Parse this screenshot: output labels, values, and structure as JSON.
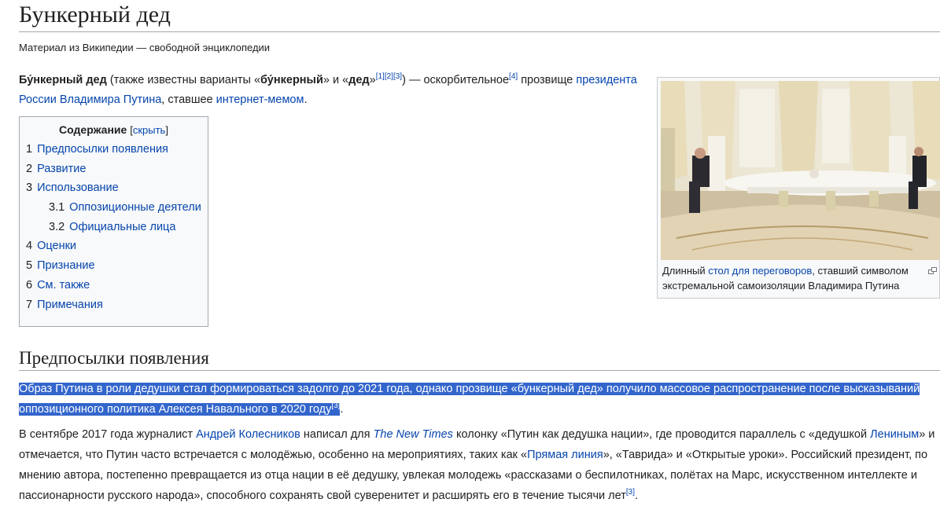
{
  "page": {
    "title": "Бункерный дед",
    "tagline": "Материал из Википедии — свободной энциклопедии"
  },
  "lead": {
    "term": "Бу́нкерный дед",
    "t1": " (также известны варианты «",
    "variant1": "бу́нкерный",
    "t2": "» и «",
    "variant2": "дед",
    "t3": "»",
    "ref1": "[1]",
    "ref2": "[2]",
    "ref3": "[3]",
    "t4": ") — оскорбительное",
    "ref4": "[4]",
    "t5": " прозвище ",
    "link1": "президента России Владимира Путина",
    "t6": ", ставшее ",
    "link2": "интернет-мемом",
    "t7": "."
  },
  "toc": {
    "heading": "Содержание",
    "toggle_open": "[",
    "toggle": "скрыть",
    "toggle_close": "]",
    "items": [
      {
        "num": "1",
        "label": "Предпосылки появления"
      },
      {
        "num": "2",
        "label": "Развитие"
      },
      {
        "num": "3",
        "label": "Использование"
      },
      {
        "num": "3.1",
        "label": "Оппозиционные деятели"
      },
      {
        "num": "3.2",
        "label": "Официальные лица"
      },
      {
        "num": "4",
        "label": "Оценки"
      },
      {
        "num": "5",
        "label": "Признание"
      },
      {
        "num": "6",
        "label": "См. также"
      },
      {
        "num": "7",
        "label": "Примечания"
      }
    ]
  },
  "figure": {
    "c1": "Длинный ",
    "link": "стол для переговоров",
    "c2": ", ставший символом экстремальной самоизоляции Владимира Путина"
  },
  "section": {
    "heading": "Предпосылки появления",
    "p1_text": "Образ Путина в роли дедушки стал формироваться задолго до 2021 года, однако прозвище «бункерный дед» получило массовое распространение после высказываний оппозиционного политика Алексея Навального в 2020 году",
    "p1_ref": "[3]",
    "p1_end": ".",
    "p2": {
      "a": "В сентябре 2017 года журналист ",
      "link1": "Андрей Колесников",
      "b": " написал для ",
      "link2": "The New Times",
      "c": " колонку «Путин как дедушка нации», где проводится параллель с «дедушкой ",
      "link3": "Лениным",
      "d": "» и отмечается, что Путин часто встречается с молодёжью, особенно на мероприятиях, таких как «",
      "link4": "Прямая линия",
      "e": "», «Таврида» и «Открытые уроки». Российский президент, по мнению автора, постепенно превращается из отца нации в её дедушку, увлекая молодежь «рассказами о беспилотниках, полётах на Марс, искусственном интеллекте и пассионарности русского народа», способного сохранять свой суверенитет и расширять его в течение тысячи лет",
      "ref": "[3]",
      "f": "."
    }
  },
  "icons": {
    "magnify": "magnify-icon"
  },
  "colors": {
    "link": "#0645ad",
    "highlight": "#3366cc"
  }
}
